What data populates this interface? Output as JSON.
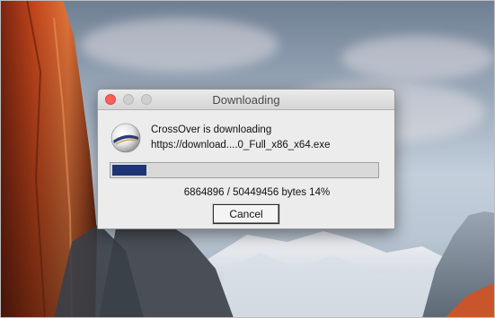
{
  "window": {
    "title": "Downloading",
    "traffic_lights": {
      "close_color": "#fc5f57",
      "minimize_color": "#cfcfcf",
      "maximize_color": "#cfcfcf"
    }
  },
  "app_icon": "crossover-ball-icon",
  "message": {
    "line1": "CrossOver is downloading",
    "line2": "https://download....0_Full_x86_x64.exe"
  },
  "progress": {
    "percent": 14,
    "fill_color": "#1f3476",
    "bytes_text": "6864896 / 50449456 bytes 14%"
  },
  "buttons": {
    "cancel_label": "Cancel"
  }
}
